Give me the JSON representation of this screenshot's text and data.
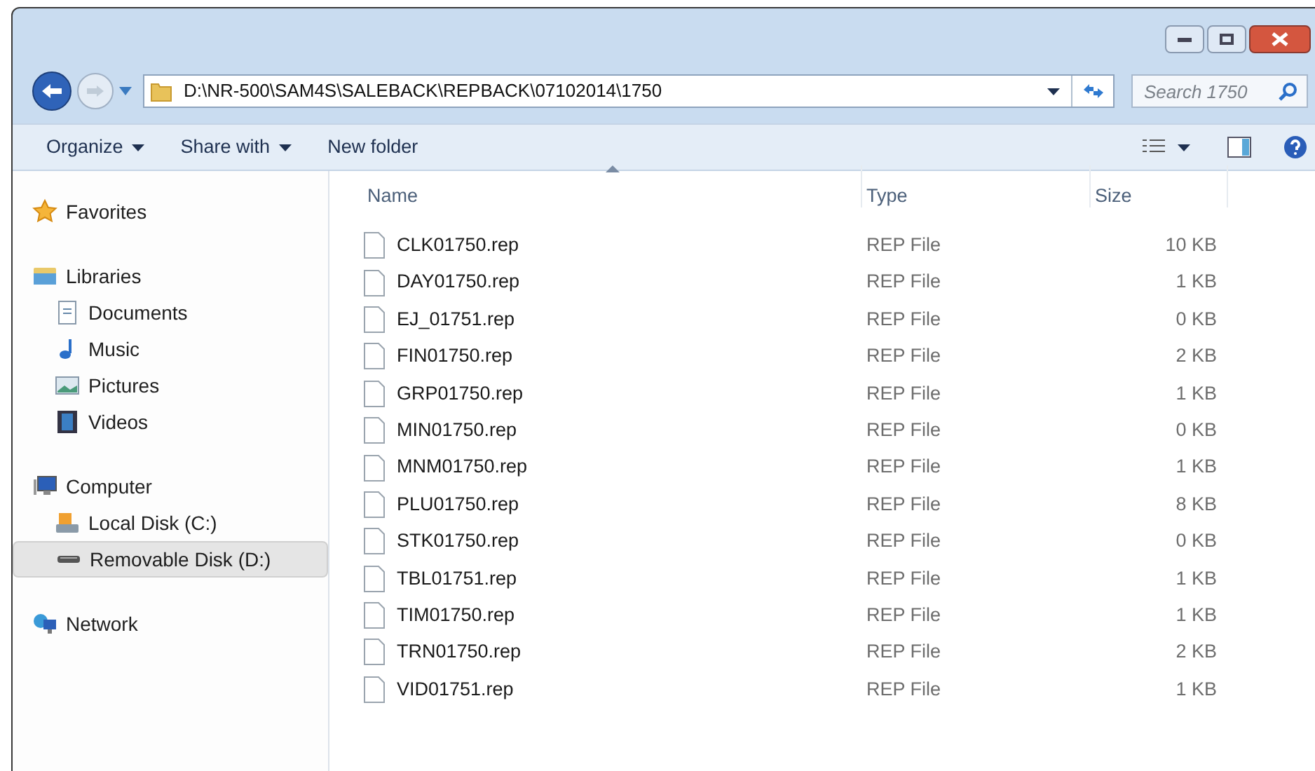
{
  "address_bar": {
    "path": "D:\\NR-500\\SAM4S\\SALEBACK\\REPBACK\\07102014\\1750"
  },
  "search": {
    "placeholder": "Search 1750"
  },
  "toolbar": {
    "buttons": [
      {
        "label": "Organize",
        "dropdown": true
      },
      {
        "label": "Share with",
        "dropdown": true
      },
      {
        "label": "New folder",
        "dropdown": false
      }
    ]
  },
  "sidebar": {
    "groups": [
      {
        "kind": "favorites",
        "label": "Favorites",
        "selected": false
      },
      {
        "kind": "libraries",
        "label": "Libraries",
        "selected": false,
        "children": [
          {
            "kind": "documents",
            "label": "Documents",
            "selected": false
          },
          {
            "kind": "music",
            "label": "Music",
            "selected": false
          },
          {
            "kind": "pictures",
            "label": "Pictures",
            "selected": false
          },
          {
            "kind": "videos",
            "label": "Videos",
            "selected": false
          }
        ]
      },
      {
        "kind": "computer",
        "label": "Computer",
        "selected": false,
        "children": [
          {
            "kind": "localdisk",
            "label": "Local Disk (C:)",
            "selected": false
          },
          {
            "kind": "removable",
            "label": "Removable Disk (D:)",
            "selected": true
          }
        ]
      },
      {
        "kind": "network",
        "label": "Network",
        "selected": false
      }
    ]
  },
  "table": {
    "columns": [
      {
        "label": "Name",
        "sorted": true
      },
      {
        "label": "Type",
        "sorted": false
      },
      {
        "label": "Size",
        "sorted": false
      }
    ],
    "rows": [
      {
        "name": "CLK01750.rep",
        "type": "REP File",
        "size": "10 KB"
      },
      {
        "name": "DAY01750.rep",
        "type": "REP File",
        "size": "1 KB"
      },
      {
        "name": "EJ_01751.rep",
        "type": "REP File",
        "size": "0 KB"
      },
      {
        "name": "FIN01750.rep",
        "type": "REP File",
        "size": "2 KB"
      },
      {
        "name": "GRP01750.rep",
        "type": "REP File",
        "size": "1 KB"
      },
      {
        "name": "MIN01750.rep",
        "type": "REP File",
        "size": "0 KB"
      },
      {
        "name": "MNM01750.rep",
        "type": "REP File",
        "size": "1 KB"
      },
      {
        "name": "PLU01750.rep",
        "type": "REP File",
        "size": "8 KB"
      },
      {
        "name": "STK01750.rep",
        "type": "REP File",
        "size": "0 KB"
      },
      {
        "name": "TBL01751.rep",
        "type": "REP File",
        "size": "1 KB"
      },
      {
        "name": "TIM01750.rep",
        "type": "REP File",
        "size": "1 KB"
      },
      {
        "name": "TRN01750.rep",
        "type": "REP File",
        "size": "2 KB"
      },
      {
        "name": "VID01751.rep",
        "type": "REP File",
        "size": "1 KB"
      }
    ]
  }
}
